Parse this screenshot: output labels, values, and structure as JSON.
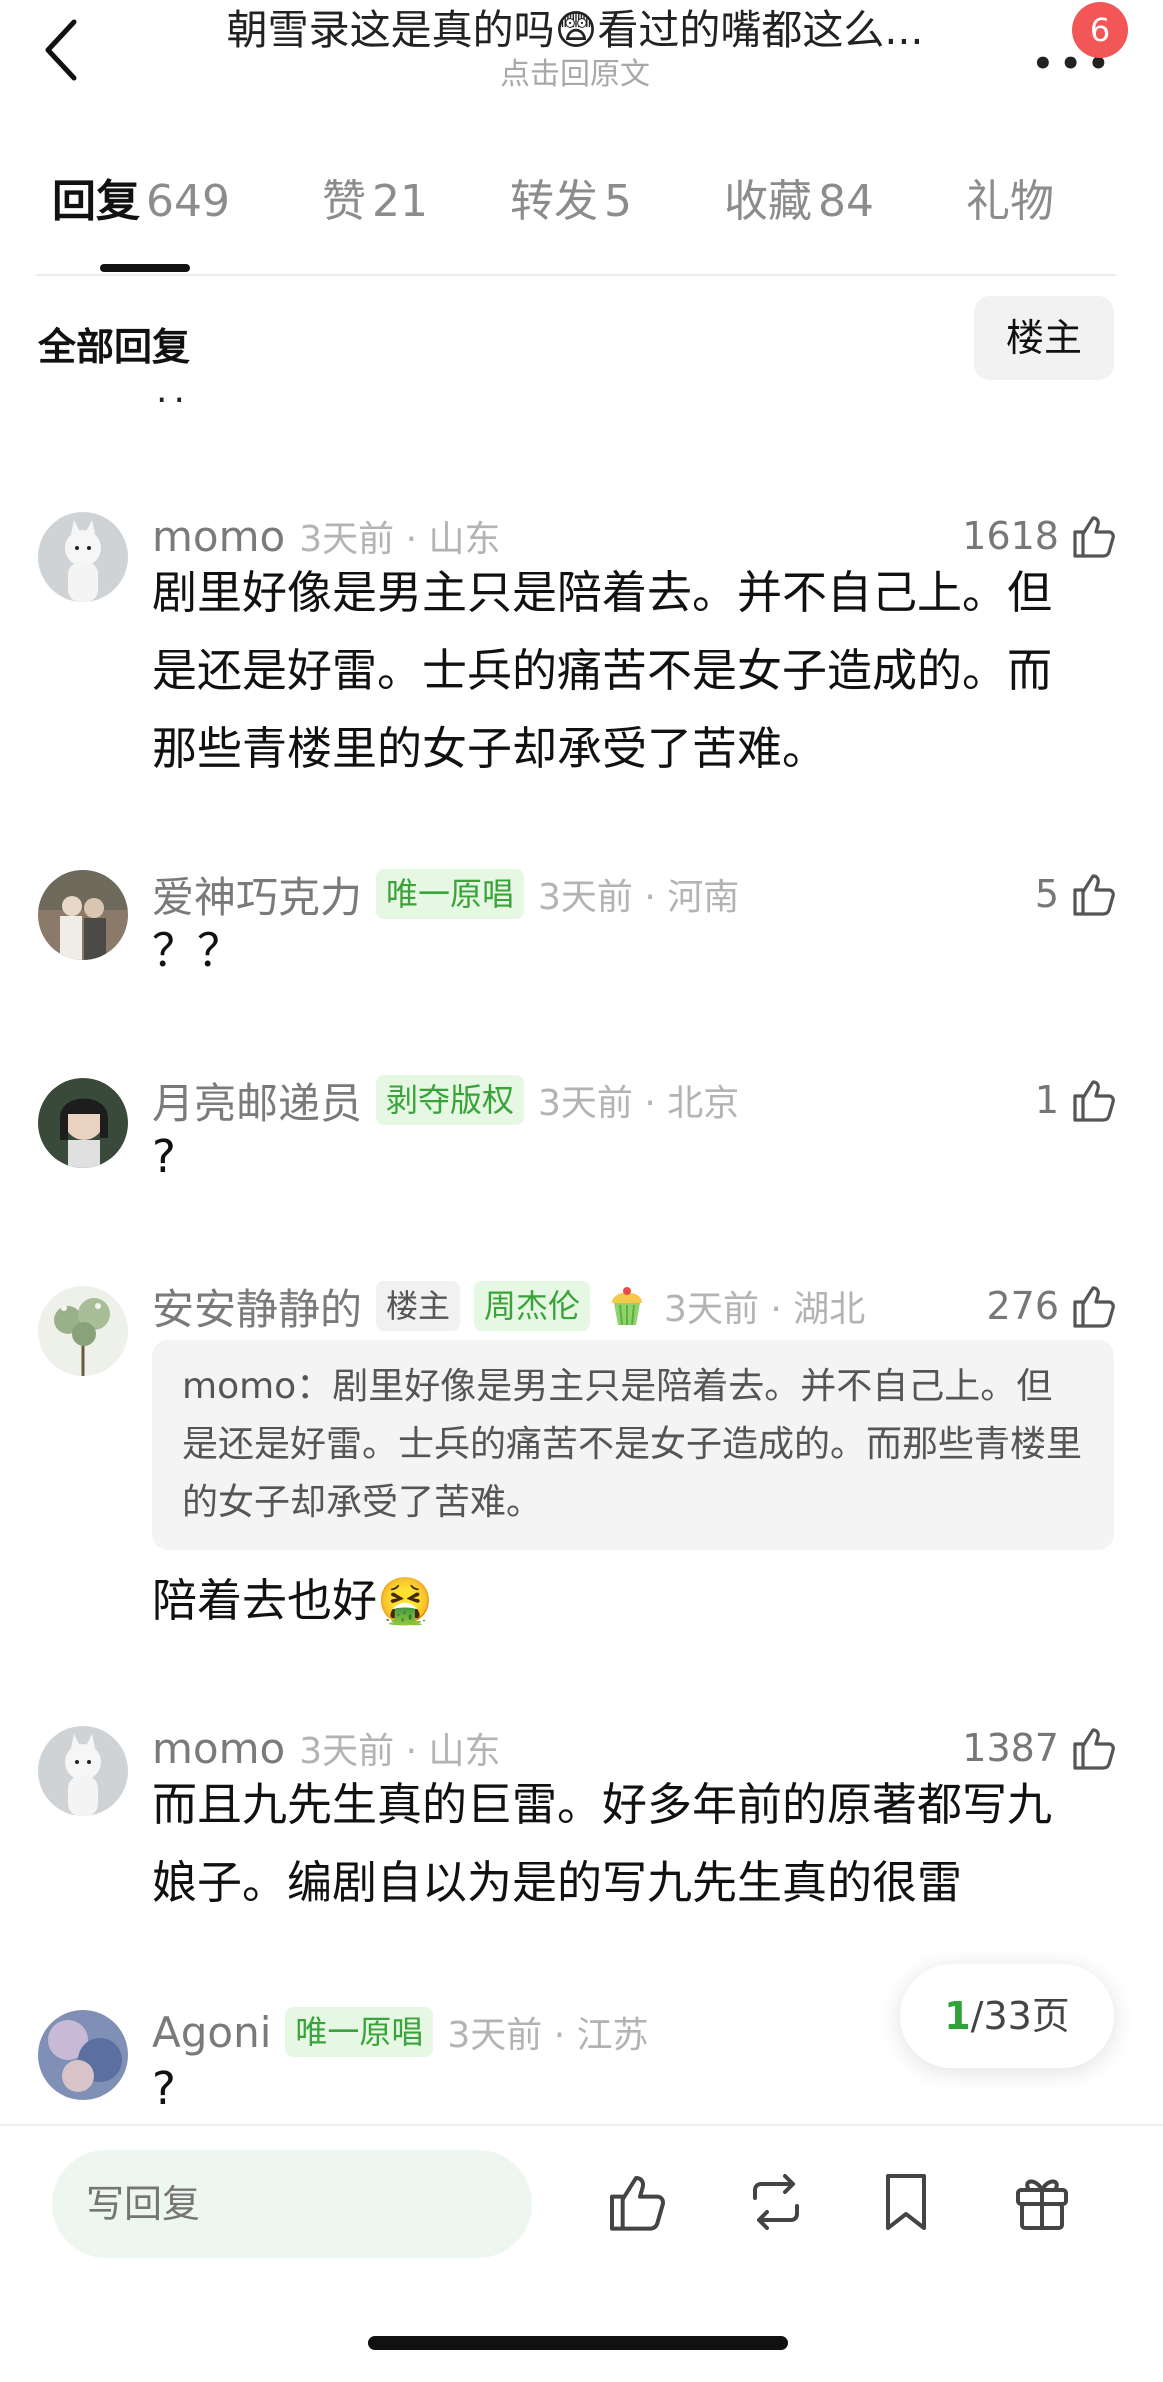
{
  "header": {
    "title": "朝雪录这是真的吗😨看过的嘴都这么...",
    "subtitle": "点击回原文",
    "notification_count": "6",
    "more_glyph": "•••"
  },
  "tabs": [
    {
      "label": "回复",
      "count": "649",
      "active": true
    },
    {
      "label": "赞",
      "count": "21"
    },
    {
      "label": "转发",
      "count": "5"
    },
    {
      "label": "收藏",
      "count": "84"
    },
    {
      "label": "礼物",
      "count": ""
    }
  ],
  "filter": {
    "label": "全部回复",
    "owner_button": "楼主",
    "fragment": "··"
  },
  "comments": [
    {
      "name": "momo",
      "time": "3天前 · 山东",
      "likes": "1618",
      "text": "剧里好像是男主只是陪着去。并不自己上。但是还是好雷。士兵的痛苦不是女子造成的。而那些青楼里的女子却承受了苦难。"
    },
    {
      "name": "爱神巧克力",
      "tag": "唯一原唱",
      "time": "3天前 · 河南",
      "likes": "5",
      "text": "？？"
    },
    {
      "name": "月亮邮递员",
      "tag": "剥夺版权",
      "time": "3天前 · 北京",
      "likes": "1",
      "text": "?"
    },
    {
      "name": "安安静静的",
      "owner_tag": "楼主",
      "tag": "周杰伦",
      "time": "3天前 · 湖北",
      "likes": "276",
      "quote": "momo：剧里好像是男主只是陪着去。并不自己上。但是还是好雷。士兵的痛苦不是女子造成的。而那些青楼里的女子却承受了苦难。",
      "text": "陪着去也好🤮"
    },
    {
      "name": "momo",
      "time": "3天前 · 山东",
      "likes": "1387",
      "text": "而且九先生真的巨雷。好多年前的原著都写九娘子。编剧自以为是的写九先生真的很雷"
    },
    {
      "name": "Agoni",
      "tag": "唯一原唱",
      "time": "3天前 · 江苏",
      "text": "?"
    }
  ],
  "pagination": {
    "current": "1",
    "total": "/33页"
  },
  "bottom_bar": {
    "reply_placeholder": "写回复",
    "icons": [
      "like-icon",
      "repost-icon",
      "bookmark-icon",
      "gift-icon"
    ]
  },
  "colors": {
    "accent_green": "#2fa33a",
    "tag_green_bg": "#e6f7e4",
    "badge_red": "#f25656",
    "input_bg": "#eef7ef"
  }
}
